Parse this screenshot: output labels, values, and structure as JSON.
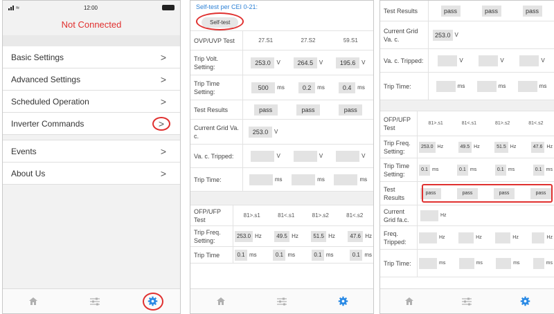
{
  "panel1": {
    "status": {
      "time": "12:00"
    },
    "connection": "Not Connected",
    "menu": [
      {
        "label": "Basic Settings"
      },
      {
        "label": "Advanced Settings"
      },
      {
        "label": "Scheduled Operation"
      },
      {
        "label": "Inverter Commands"
      },
      {
        "label": "Events"
      },
      {
        "label": "About Us"
      }
    ],
    "chevron": ">"
  },
  "panel2": {
    "title": "Self-test per CEI 0-21:",
    "selftest_button": "Self-test",
    "ovp": {
      "label": "OVP/UVP Test",
      "cols": [
        "27.S1",
        "27.S2",
        "59.S1"
      ],
      "trip_volt_label": "Trip Volt. Setting:",
      "trip_volt": [
        "253.0",
        "264.5",
        "195.6"
      ],
      "unit_v": "V",
      "trip_time_label": "Trip Time Setting:",
      "trip_time": [
        "500",
        "0.2",
        "0.4"
      ],
      "unit_ms": "ms",
      "results_label": "Test Results",
      "results": [
        "pass",
        "pass",
        "pass"
      ],
      "grid_label": "Current Grid Va. c.",
      "grid_value": "253.0",
      "tripped_label": "Va. c. Tripped:",
      "triptime_label": "Trip Time:"
    },
    "ofp": {
      "label": "OFP/UFP Test",
      "cols": [
        "81>.s1",
        "81<.s1",
        "81>.s2",
        "81<.s2"
      ],
      "freq_label": "Trip Freq. Setting:",
      "freq": [
        "253.0",
        "49.5",
        "51.5",
        "47.6"
      ],
      "unit_hz": "Hz",
      "time_label": "Trip Time",
      "time": [
        "0.1",
        "0.1",
        "0.1",
        "0.1"
      ],
      "unit_ms": "ms"
    }
  },
  "panel3": {
    "top_results_label": "Test Results",
    "top_results": [
      "pass",
      "pass",
      "pass"
    ],
    "grid_label": "Current Grid Va. c.",
    "grid_value": "253.0",
    "unit_v": "V",
    "tripped_label": "Va. c. Tripped:",
    "triptime_label": "Trip Time:",
    "unit_ms": "ms",
    "ofp": {
      "label": "OFP/UFP Test",
      "cols": [
        "81>.s1",
        "81<.s1",
        "81>.s2",
        "81<.s2"
      ],
      "freq_label": "Trip Freq. Setting:",
      "freq": [
        "253.0",
        "49.5",
        "51.5",
        "47.6"
      ],
      "unit_hz": "Hz",
      "time_label": "Trip Time Setting:",
      "time": [
        "0.1",
        "0.1",
        "0.1",
        "0.1"
      ],
      "results_label": "Test Results",
      "results": [
        "pass",
        "pass",
        "pass",
        "pass"
      ],
      "grid_label": "Current Grid fa.c.",
      "freq_tripped_label": "Freq. Tripped:",
      "triptime_label": "Trip Time:"
    }
  }
}
